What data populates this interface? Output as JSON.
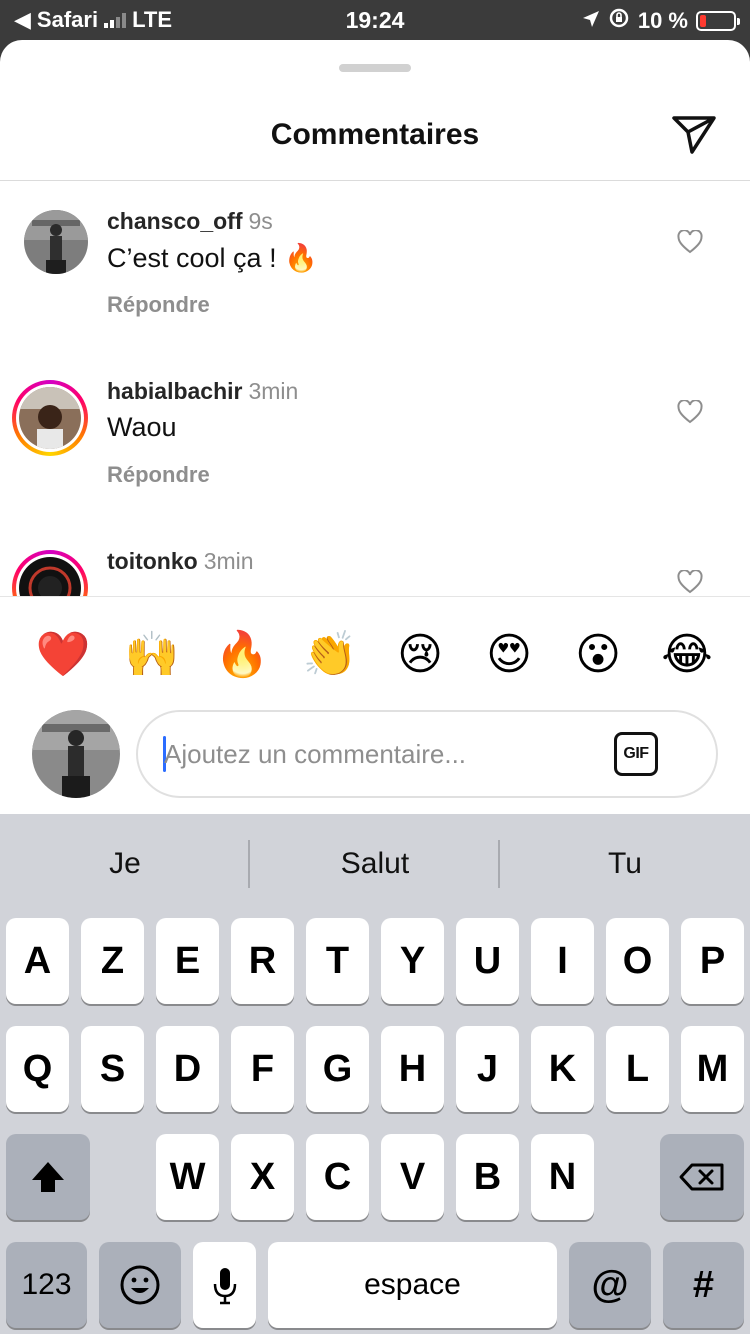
{
  "status_bar": {
    "back_app": "Safari",
    "network": "LTE",
    "time": "19:24",
    "battery_percent": "10 %",
    "battery_level": 0.1
  },
  "sheet": {
    "title": "Commentaires",
    "send_icon": "paper-plane-icon"
  },
  "comments": [
    {
      "username": "chansco_off",
      "time": "9s",
      "text": "C’est cool ça ! 🔥",
      "reply_label": "Répondre",
      "has_story_ring": false
    },
    {
      "username": "habialbachir",
      "time": "3min",
      "text": "Waou",
      "reply_label": "Répondre",
      "has_story_ring": true
    },
    {
      "username": "toitonko",
      "time": "3min",
      "text": "",
      "reply_label": "",
      "has_story_ring": true
    }
  ],
  "reactions": [
    "❤️",
    "🙌",
    "🔥",
    "👏",
    "😢",
    "😍",
    "😮",
    "😂"
  ],
  "composer": {
    "placeholder": "Ajoutez un commentaire...",
    "gif_label": "GIF"
  },
  "keyboard": {
    "suggestions": [
      "Je",
      "Salut",
      "Tu"
    ],
    "row1": [
      "A",
      "Z",
      "E",
      "R",
      "T",
      "Y",
      "U",
      "I",
      "O",
      "P"
    ],
    "row2": [
      "Q",
      "S",
      "D",
      "F",
      "G",
      "H",
      "J",
      "K",
      "L",
      "M"
    ],
    "row3": [
      "W",
      "X",
      "C",
      "V",
      "B",
      "N"
    ],
    "numbers_label": "123",
    "space_label": "espace",
    "at_label": "@",
    "hash_label": "#"
  },
  "colors": {
    "story_ring": [
      "#d300c5",
      "#ff0069",
      "#ffd600"
    ],
    "caret": "#2b6cff",
    "battery_low": "#ff3b30"
  }
}
